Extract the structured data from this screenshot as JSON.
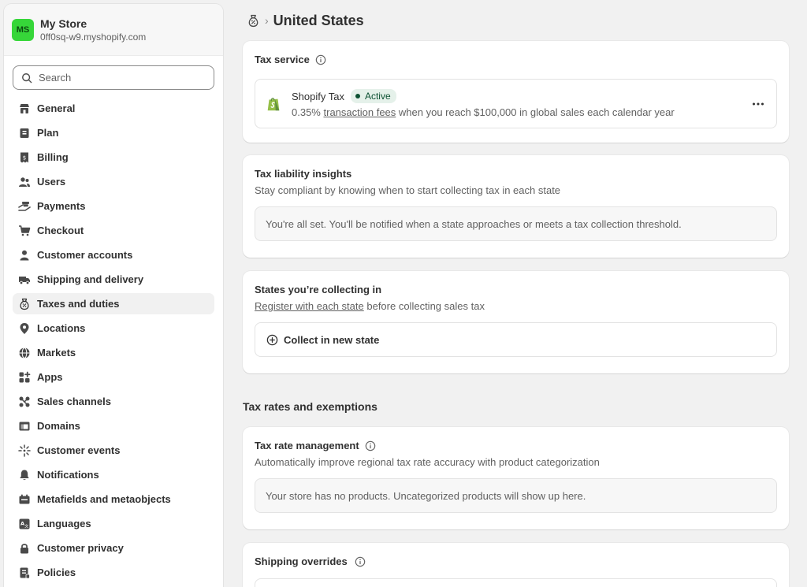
{
  "store": {
    "avatar_initials": "MS",
    "name": "My Store",
    "domain": "0ff0sq-w9.myshopify.com",
    "avatar_color": "#36d639"
  },
  "search": {
    "placeholder": "Search"
  },
  "sidebar": {
    "items": [
      {
        "label": "General",
        "icon": "store-icon"
      },
      {
        "label": "Plan",
        "icon": "plan-icon"
      },
      {
        "label": "Billing",
        "icon": "billing-icon"
      },
      {
        "label": "Users",
        "icon": "users-icon"
      },
      {
        "label": "Payments",
        "icon": "payments-icon"
      },
      {
        "label": "Checkout",
        "icon": "cart-icon"
      },
      {
        "label": "Customer accounts",
        "icon": "person-icon"
      },
      {
        "label": "Shipping and delivery",
        "icon": "truck-icon"
      },
      {
        "label": "Taxes and duties",
        "icon": "tax-bag-icon",
        "active": true
      },
      {
        "label": "Locations",
        "icon": "location-pin-icon"
      },
      {
        "label": "Markets",
        "icon": "globe-icon"
      },
      {
        "label": "Apps",
        "icon": "apps-icon"
      },
      {
        "label": "Sales channels",
        "icon": "sales-channels-icon"
      },
      {
        "label": "Domains",
        "icon": "domains-icon"
      },
      {
        "label": "Customer events",
        "icon": "sparkle-icon"
      },
      {
        "label": "Notifications",
        "icon": "bell-icon"
      },
      {
        "label": "Metafields and metaobjects",
        "icon": "metafields-icon"
      },
      {
        "label": "Languages",
        "icon": "languages-icon"
      },
      {
        "label": "Customer privacy",
        "icon": "lock-icon"
      },
      {
        "label": "Policies",
        "icon": "policies-icon"
      }
    ]
  },
  "header": {
    "breadcrumb_icon": "tax-bag-icon",
    "separator": "›",
    "title": "United States"
  },
  "tax_service": {
    "title": "Tax service",
    "provider_name": "Shopify Tax",
    "status": "Active",
    "rate": "0.35%",
    "link_text": "transaction fees",
    "description_rest": "when you reach $100,000 in global sales each calendar year",
    "status_color": "#0c5132"
  },
  "liability": {
    "title": "Tax liability insights",
    "subtitle": "Stay compliant by knowing when to start collecting tax in each state",
    "notice": "You're all set. You'll be notified when a state approaches or meets a tax collection threshold."
  },
  "states": {
    "title": "States you’re collecting in",
    "link_text": "Register with each state",
    "subtitle_rest": "before collecting sales tax",
    "button_label": "Collect in new state"
  },
  "rates_section": {
    "heading": "Tax rates and exemptions"
  },
  "rate_management": {
    "title": "Tax rate management",
    "subtitle": "Automatically improve regional tax rate accuracy with product categorization",
    "notice": "Your store has no products. Uncategorized products will show up here."
  },
  "shipping_overrides": {
    "title": "Shipping overrides"
  }
}
